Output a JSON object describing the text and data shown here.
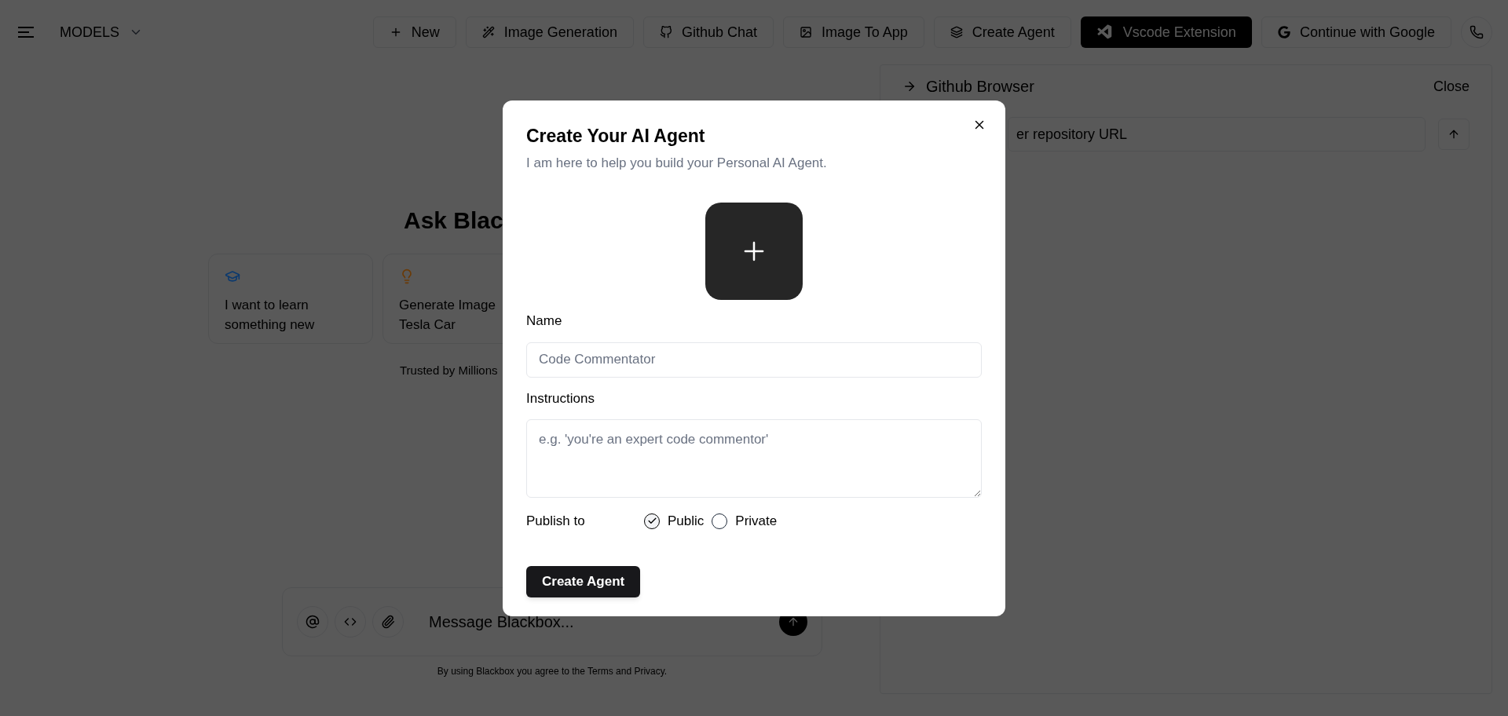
{
  "nav": {
    "models_label": "MODELS"
  },
  "top_buttons": [
    {
      "label": "New",
      "selected": false
    },
    {
      "label": "Image Generation",
      "selected": false
    },
    {
      "label": "Github Chat",
      "selected": false
    },
    {
      "label": "Image To App",
      "selected": false
    },
    {
      "label": "Create Agent",
      "selected": false
    },
    {
      "label": "Vscode Extension",
      "selected": true
    },
    {
      "label": "Continue with Google",
      "selected": false
    }
  ],
  "chat": {
    "heading": "Ask Blac",
    "suggestions": [
      {
        "lines": [
          "I want to learn",
          "something new"
        ],
        "color": "#0c3a6e"
      },
      {
        "lines": [
          "Generate Image",
          "Tesla Car"
        ],
        "color": "#6b3a06"
      }
    ],
    "trusted": "Trusted by Millions",
    "message_placeholder": "Message Blackbox...",
    "disclaimer": "By using Blackbox you agree to the Terms and Privacy."
  },
  "github_panel": {
    "title": "Github Browser",
    "close": "Close",
    "url_placeholder": "er repository URL"
  },
  "modal": {
    "title": "Create Your AI Agent",
    "subtitle": "I am here to help you build your Personal AI Agent.",
    "name_label": "Name",
    "name_placeholder": "Code Commentator",
    "instructions_label": "Instructions",
    "instructions_placeholder": "e.g. 'you're an expert code commentor'",
    "publish_label": "Publish to",
    "publish_options": [
      {
        "label": "Public",
        "selected": true
      },
      {
        "label": "Private",
        "selected": false
      }
    ],
    "submit": "Create Agent"
  }
}
